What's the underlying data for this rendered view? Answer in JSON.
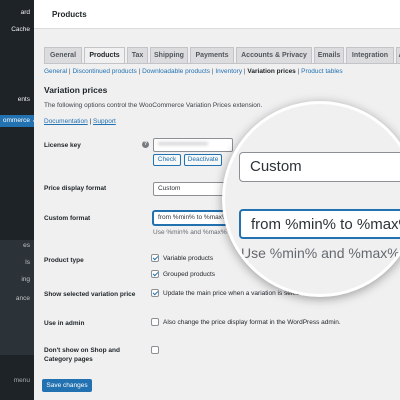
{
  "sidebar": {
    "items": [
      {
        "label": "ard"
      },
      {
        "label": "Cache"
      },
      {
        "label": "ents"
      },
      {
        "label": "ommerce",
        "active": true
      }
    ],
    "submenu": [
      {
        "label": "es"
      },
      {
        "label": "ls"
      },
      {
        "label": "ing"
      },
      {
        "label": "ance"
      }
    ],
    "collapse_label": "menu"
  },
  "header": {
    "page_title": "Products"
  },
  "tabs": [
    {
      "label": "General"
    },
    {
      "label": "Products",
      "active": true
    },
    {
      "label": "Tax"
    },
    {
      "label": "Shipping"
    },
    {
      "label": "Payments"
    },
    {
      "label": "Accounts & Privacy"
    },
    {
      "label": "Emails"
    },
    {
      "label": "Integration"
    },
    {
      "label": "A"
    }
  ],
  "sublinks": [
    {
      "label": "General",
      "sep": " | "
    },
    {
      "label": "Discontinued products",
      "sep": " | "
    },
    {
      "label": "Downloadable products",
      "sep": " | "
    },
    {
      "label": "Inventory",
      "sep": " | "
    },
    {
      "label": "Variation prices",
      "current": true,
      "sep": " | "
    },
    {
      "label": "Product tables",
      "sep": ""
    }
  ],
  "section": {
    "title": "Variation prices",
    "description": "The following options control the WooCommerce Variation Prices extension.",
    "documentation_link": "Documentation",
    "separator": " | ",
    "support_link": "Support"
  },
  "fields": {
    "license_key": {
      "label": "License key",
      "value": "••••••••••••••••••••••",
      "check_button": "Check",
      "deactivate_button": "Deactivate"
    },
    "price_display_format": {
      "label": "Price display format",
      "value": "Custom"
    },
    "custom_format": {
      "label": "Custom format",
      "value": "from %min% to %max%",
      "hint": "Use %min% and %max%"
    },
    "product_type": {
      "label": "Product type",
      "options": [
        {
          "label": "Variable products",
          "checked": true
        },
        {
          "label": "Grouped products",
          "checked": true
        }
      ]
    },
    "show_selected": {
      "label": "Show selected variation price",
      "checkbox_label": "Update the main price when a variation is selected.",
      "checked": true
    },
    "use_in_admin": {
      "label": "Use in admin",
      "checkbox_label": "Also change the price display format in the WordPress admin.",
      "checked": false
    },
    "dont_show": {
      "label": "Don't show on Shop and Category pages",
      "checked": false
    }
  },
  "save_button": "Save changes",
  "magnifier": {
    "select_value": "Custom",
    "input_value": "from %min% to %max%",
    "hint": "Use %min% and %max%"
  },
  "colors": {
    "accent": "#2271b1",
    "sidebar_bg": "#1d2327",
    "page_bg": "#f0f0f1"
  }
}
